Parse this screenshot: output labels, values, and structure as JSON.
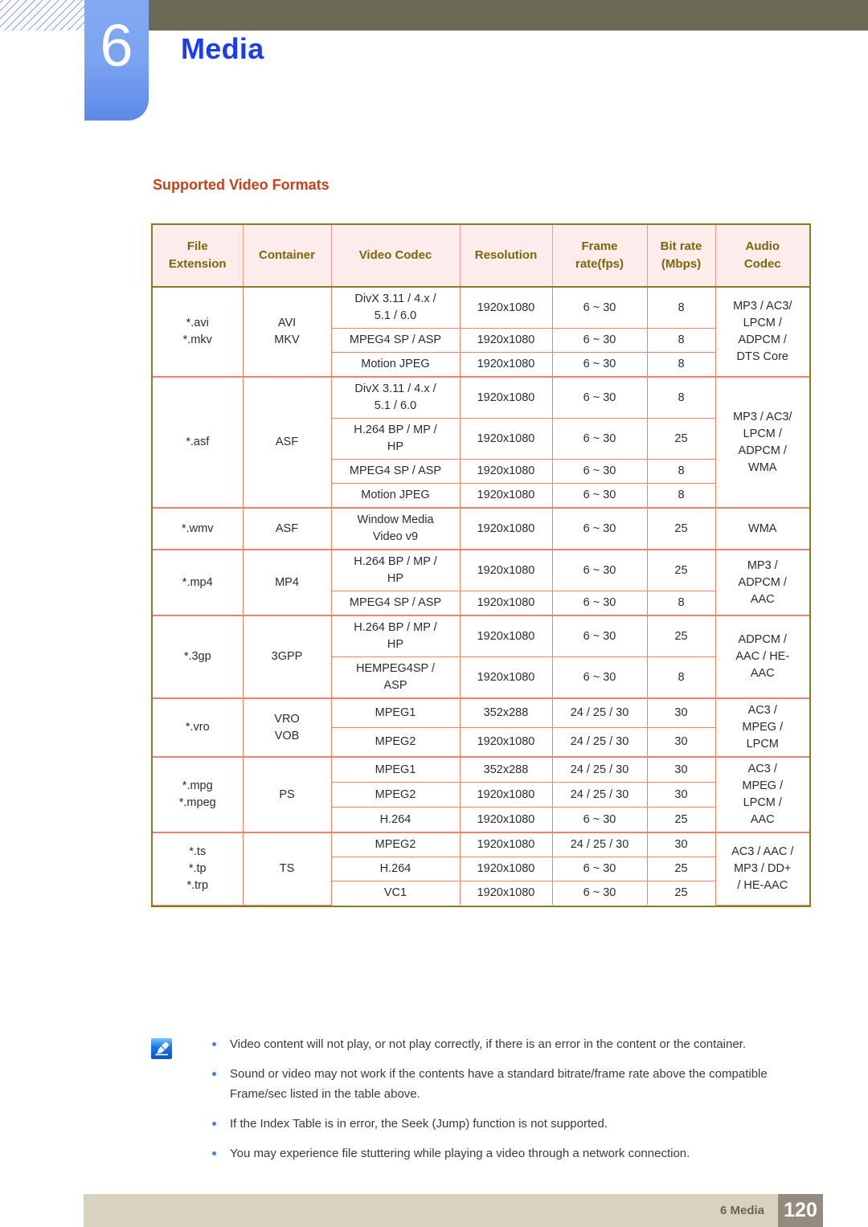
{
  "header": {
    "chapter_number": "6",
    "chapter_title": "Media",
    "accent_blue": "#1a3df0",
    "badge_blue": "#7ca3ef",
    "olive": "#6b6a55"
  },
  "section": {
    "title": "Supported Video Formats",
    "title_color": "#c2421b"
  },
  "table": {
    "columns": [
      {
        "line1": "File",
        "line2": "Extension"
      },
      {
        "line1": "Container",
        "line2": ""
      },
      {
        "line1": "Video Codec",
        "line2": ""
      },
      {
        "line1": "Resolution",
        "line2": ""
      },
      {
        "line1": "Frame",
        "line2": "rate(fps)"
      },
      {
        "line1": "Bit rate",
        "line2": "(Mbps)"
      },
      {
        "line1": "Audio",
        "line2": "Codec"
      }
    ],
    "header_bg": "#fcecec",
    "header_text_color": "#7d6608",
    "outer_border_color": "#8a7a28",
    "inner_border_color": "#e8846a",
    "groups": [
      {
        "file_extension": "*.avi\n*.mkv",
        "container": "AVI\nMKV",
        "audio_codec": "MP3 / AC3/\nLPCM /\nADPCM /\nDTS Core",
        "rows": [
          {
            "video_codec": "DivX 3.11 / 4.x /\n5.1 / 6.0",
            "resolution": "1920x1080",
            "frame_rate": "6 ~ 30",
            "bit_rate": "8"
          },
          {
            "video_codec": "MPEG4 SP / ASP",
            "resolution": "1920x1080",
            "frame_rate": "6 ~ 30",
            "bit_rate": "8"
          },
          {
            "video_codec": "Motion JPEG",
            "resolution": "1920x1080",
            "frame_rate": "6 ~ 30",
            "bit_rate": "8"
          }
        ]
      },
      {
        "file_extension": "*.asf",
        "container": "ASF",
        "audio_codec": "MP3 / AC3/\nLPCM /\nADPCM /\nWMA",
        "rows": [
          {
            "video_codec": "DivX 3.11 / 4.x /\n5.1 / 6.0",
            "resolution": "1920x1080",
            "frame_rate": "6 ~ 30",
            "bit_rate": "8"
          },
          {
            "video_codec": "H.264 BP / MP /\nHP",
            "resolution": "1920x1080",
            "frame_rate": "6 ~ 30",
            "bit_rate": "25"
          },
          {
            "video_codec": "MPEG4 SP / ASP",
            "resolution": "1920x1080",
            "frame_rate": "6 ~ 30",
            "bit_rate": "8"
          },
          {
            "video_codec": "Motion JPEG",
            "resolution": "1920x1080",
            "frame_rate": "6 ~ 30",
            "bit_rate": "8"
          }
        ]
      },
      {
        "file_extension": "*.wmv",
        "container": "ASF",
        "audio_codec": "WMA",
        "rows": [
          {
            "video_codec": "Window Media\nVideo v9",
            "resolution": "1920x1080",
            "frame_rate": "6 ~ 30",
            "bit_rate": "25"
          }
        ]
      },
      {
        "file_extension": "*.mp4",
        "container": "MP4",
        "audio_codec": "MP3 /\nADPCM /\nAAC",
        "rows": [
          {
            "video_codec": "H.264 BP / MP /\nHP",
            "resolution": "1920x1080",
            "frame_rate": "6 ~ 30",
            "bit_rate": "25"
          },
          {
            "video_codec": "MPEG4 SP / ASP",
            "resolution": "1920x1080",
            "frame_rate": "6 ~ 30",
            "bit_rate": "8"
          }
        ]
      },
      {
        "file_extension": "*.3gp",
        "container": "3GPP",
        "audio_codec": "ADPCM /\nAAC / HE-\nAAC",
        "rows": [
          {
            "video_codec": "H.264 BP / MP /\nHP",
            "resolution": "1920x1080",
            "frame_rate": "6 ~ 30",
            "bit_rate": "25"
          },
          {
            "video_codec": "HEMPEG4SP /\nASP",
            "resolution": "1920x1080",
            "frame_rate": "6 ~ 30",
            "bit_rate": "8"
          }
        ]
      },
      {
        "file_extension": "*.vro",
        "container": "VRO\nVOB",
        "audio_codec": "AC3 /\nMPEG /\nLPCM",
        "rows": [
          {
            "video_codec": "MPEG1",
            "resolution": "352x288",
            "frame_rate": "24 / 25 / 30",
            "bit_rate": "30"
          },
          {
            "video_codec": "MPEG2",
            "resolution": "1920x1080",
            "frame_rate": "24 / 25 / 30",
            "bit_rate": "30"
          }
        ]
      },
      {
        "file_extension": "*.mpg\n*.mpeg",
        "container": "PS",
        "audio_codec": "AC3 /\nMPEG /\nLPCM /\nAAC",
        "rows": [
          {
            "video_codec": "MPEG1",
            "resolution": "352x288",
            "frame_rate": "24 / 25 / 30",
            "bit_rate": "30"
          },
          {
            "video_codec": "MPEG2",
            "resolution": "1920x1080",
            "frame_rate": "24 / 25 / 30",
            "bit_rate": "30"
          },
          {
            "video_codec": "H.264",
            "resolution": "1920x1080",
            "frame_rate": "6 ~ 30",
            "bit_rate": "25"
          }
        ]
      },
      {
        "file_extension": "*.ts\n*.tp\n*.trp",
        "container": "TS",
        "audio_codec": "AC3 / AAC /\nMP3 / DD+\n/ HE-AAC",
        "rows": [
          {
            "video_codec": "MPEG2",
            "resolution": "1920x1080",
            "frame_rate": "24 / 25 / 30",
            "bit_rate": "30"
          },
          {
            "video_codec": "H.264",
            "resolution": "1920x1080",
            "frame_rate": "6 ~ 30",
            "bit_rate": "25"
          },
          {
            "video_codec": "VC1",
            "resolution": "1920x1080",
            "frame_rate": "6 ~ 30",
            "bit_rate": "25"
          }
        ]
      }
    ]
  },
  "notes": {
    "icon": "note-pen-icon",
    "items": [
      "Video content will not play, or not play correctly, if there is an error in the content or the container.",
      "Sound or video may not work if the contents have a standard bitrate/frame rate above the compatible Frame/sec listed in the table above.",
      "If the Index Table is in error, the Seek (Jump) function is not supported.",
      "You may experience file stuttering while playing a video through a network connection."
    ]
  },
  "footer": {
    "label": "6 Media",
    "page_number": "120",
    "bar_color": "#d8d3bf",
    "page_box_color": "#958a7e"
  }
}
